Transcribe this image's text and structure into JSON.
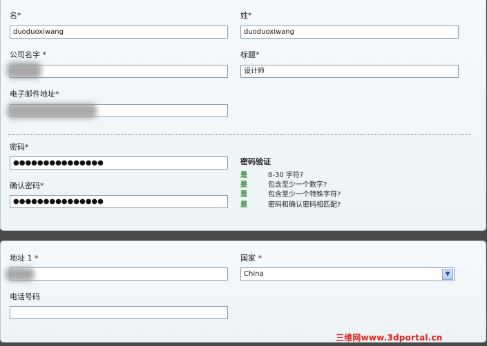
{
  "form": {
    "first_name": {
      "label": "名*",
      "value": "duoduoxiwang"
    },
    "last_name": {
      "label": "姓*",
      "value": "duoduoxiwang"
    },
    "company": {
      "label": "公司名字 *",
      "value": ""
    },
    "title": {
      "label": "标题*",
      "value": "设计师"
    },
    "email": {
      "label": "电子邮件地址*",
      "value": ""
    },
    "password": {
      "label": "密码*",
      "value": "●●●●●●●●●●●●●●●"
    },
    "confirm_password": {
      "label": "确认密码*",
      "value": "●●●●●●●●●●●●●●●"
    },
    "address1": {
      "label": "地址 1 *",
      "value": ""
    },
    "country": {
      "label": "国家 *",
      "value": "China"
    },
    "phone": {
      "label": "电话号码",
      "value": ""
    }
  },
  "password_validation": {
    "title": "密码验证",
    "rules": [
      {
        "status": "是",
        "text": "8-30 字符?"
      },
      {
        "status": "是",
        "text": "包含至少一个数字?"
      },
      {
        "status": "是",
        "text": "包含至少一个特殊字符?"
      },
      {
        "status": "是",
        "text": "密码和确认密码相匹配?"
      }
    ]
  },
  "watermark": "三维网www.3dportal.cn",
  "colors": {
    "ok": "#2d8a2d",
    "watermark": "#e0241b",
    "field_border": "#7f9db9"
  },
  "icons": {
    "country_dropdown": "chevron-down-icon"
  }
}
